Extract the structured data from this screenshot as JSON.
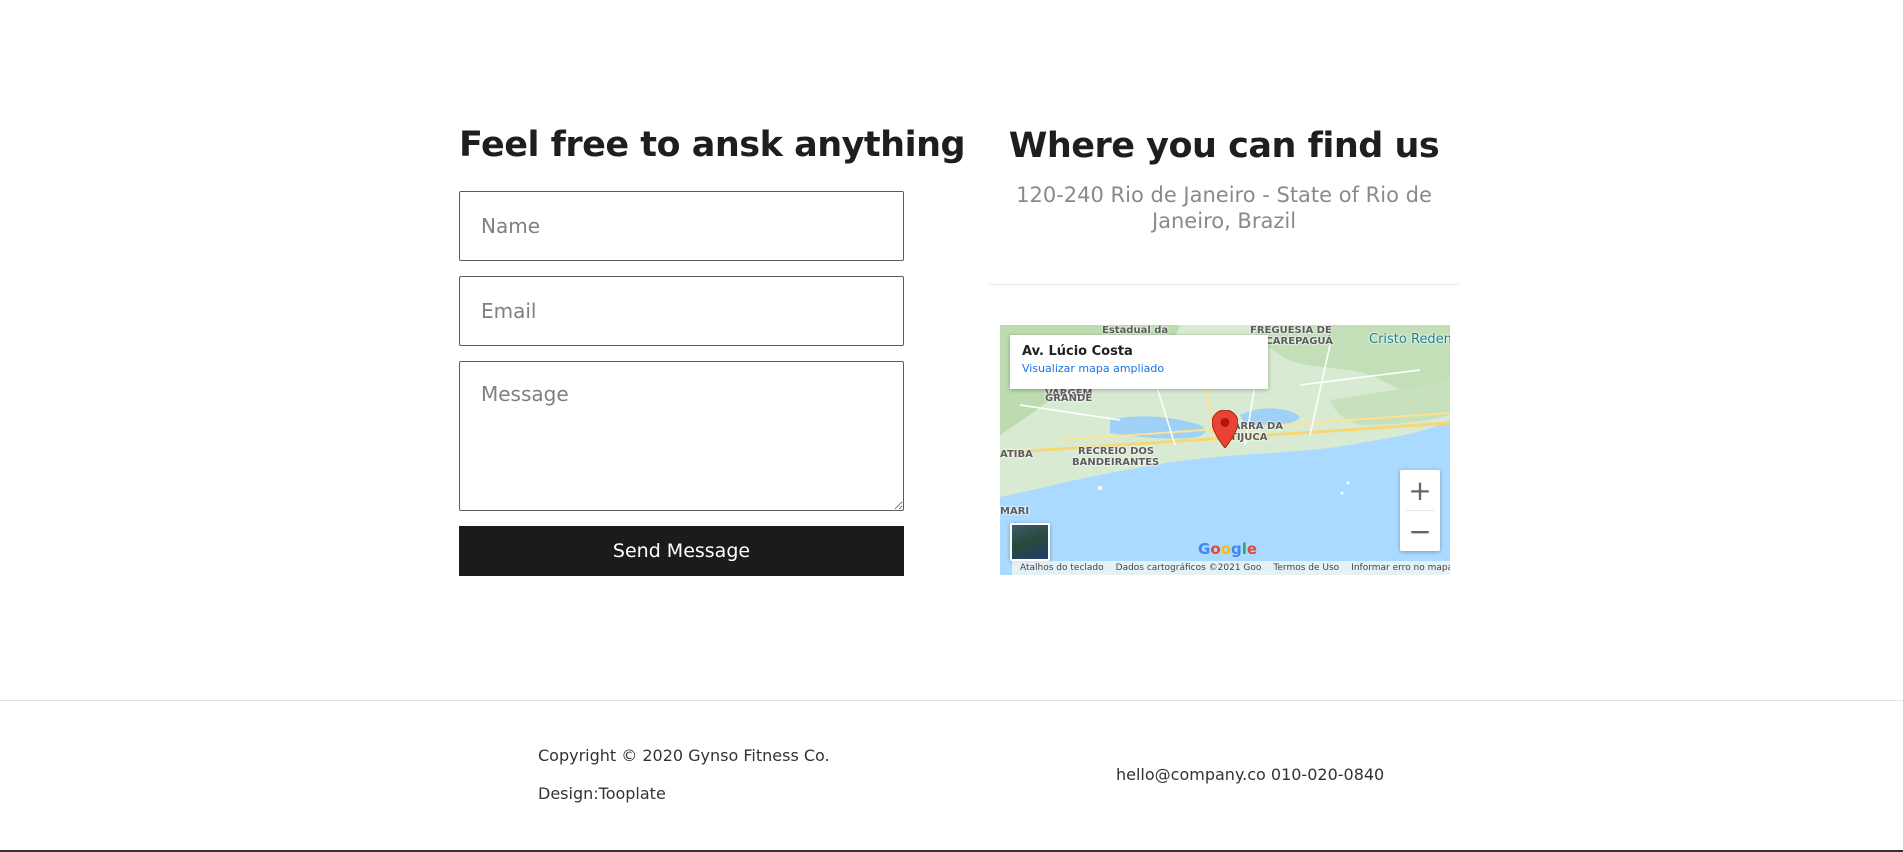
{
  "contact_form": {
    "title": "Feel free to ansk anything",
    "name_placeholder": "Name",
    "email_placeholder": "Email",
    "message_placeholder": "Message",
    "send_label": "Send Message"
  },
  "location": {
    "title": "Where you can find us",
    "address": "120-240 Rio de Janeiro - State of Rio de Janeiro, Brazil"
  },
  "map": {
    "info_card": {
      "place": "Av. Lúcio Costa",
      "larger_map_link": "Visualizar mapa ampliado"
    },
    "labels": {
      "estadual": "Estadual da",
      "freguesia": "FREGUESIA DE",
      "jacarepagua": "JACAREPAGUÁ",
      "cristo": "Cristo Reden",
      "vargem": "VARGEM",
      "grande": "GRANDE",
      "barra_1": "BARRA DA",
      "barra_2": "TIJUCA",
      "recreio_1": "RECREIO DOS",
      "recreio_2": "BANDEIRANTES",
      "tiba": "ATIBA",
      "mari": "MARI"
    },
    "zoom_in": "+",
    "zoom_out": "−",
    "google_logo": "Google",
    "footer": {
      "shortcuts": "Atalhos do teclado",
      "map_data": "Dados cartográficos ©2021 Goo",
      "terms": "Termos de Uso",
      "report": "Informar erro no mapa"
    },
    "colors": {
      "water": "#aadaff",
      "land": "#d8ebd2",
      "pin": "#ea4335"
    }
  },
  "footer": {
    "copyright": "Copyright © 2020 Gynso Fitness Co.",
    "design_prefix": "Design:",
    "design_link": "Tooplate",
    "email": "hello@company.co",
    "phone": "010-020-0840"
  }
}
